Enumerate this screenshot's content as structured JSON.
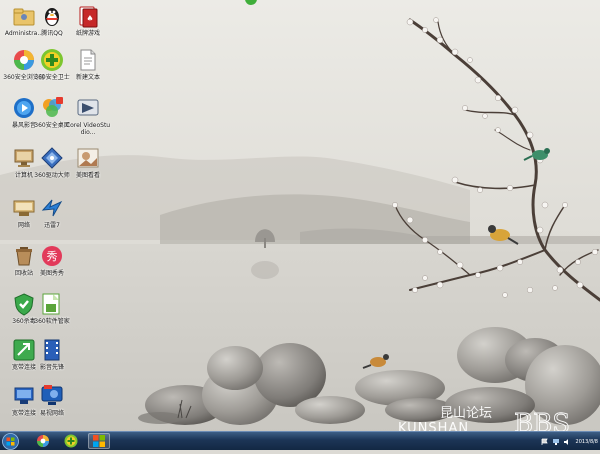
{
  "desktop": {
    "icons": [
      {
        "label": "Administra...",
        "icon": "user-folder-icon"
      },
      {
        "label": "腾讯QQ",
        "icon": "qq-penguin-icon"
      },
      {
        "label": "纸牌游戏",
        "icon": "cards-icon"
      },
      {
        "label": "360安全浏览器",
        "icon": "browser-icon"
      },
      {
        "label": "360安全卫士",
        "icon": "shield-plus-icon"
      },
      {
        "label": "新建文本",
        "icon": "document-icon"
      },
      {
        "label": "暴风影音",
        "icon": "media-player-icon"
      },
      {
        "label": "360安全桌面",
        "icon": "colorful-app-icon"
      },
      {
        "label": "Corel VideoStudio...",
        "icon": "video-editor-icon"
      },
      {
        "label": "计算机",
        "icon": "computer-icon"
      },
      {
        "label": "360驱动大师",
        "icon": "driver-icon"
      },
      {
        "label": "美图看看",
        "icon": "photo-viewer-icon"
      },
      {
        "label": "网络",
        "icon": "network-icon"
      },
      {
        "label": "迅雷7",
        "icon": "thunder-bird-icon"
      },
      {
        "label": "回收站",
        "icon": "recycle-bin-icon"
      },
      {
        "label": "美图秀秀",
        "icon": "meitu-icon"
      },
      {
        "label": "360杀毒",
        "icon": "antivirus-icon"
      },
      {
        "label": "360软件管家",
        "icon": "software-manager-icon"
      },
      {
        "label": "宽带连接",
        "icon": "broadband-icon"
      },
      {
        "label": "影音先锋",
        "icon": "film-icon"
      },
      {
        "label": "宽带连接",
        "icon": "network-connection-icon"
      },
      {
        "label": "易视网络",
        "icon": "tv-icon"
      }
    ]
  },
  "taskbar": {
    "pinned": [
      {
        "name": "360-browser",
        "icon": "browser-icon"
      },
      {
        "name": "360-security",
        "icon": "shield-plus-icon"
      },
      {
        "name": "windows-explorer",
        "icon": "windows-tiles-icon"
      }
    ],
    "clock": "2013/8/8"
  },
  "watermark": {
    "text_cn": "昆山论坛",
    "text_en": "KUNSHAN",
    "text_bbs": "BBS"
  },
  "colors": {
    "taskbar": "#1c3556",
    "wallpaper": "#dcdad4"
  }
}
